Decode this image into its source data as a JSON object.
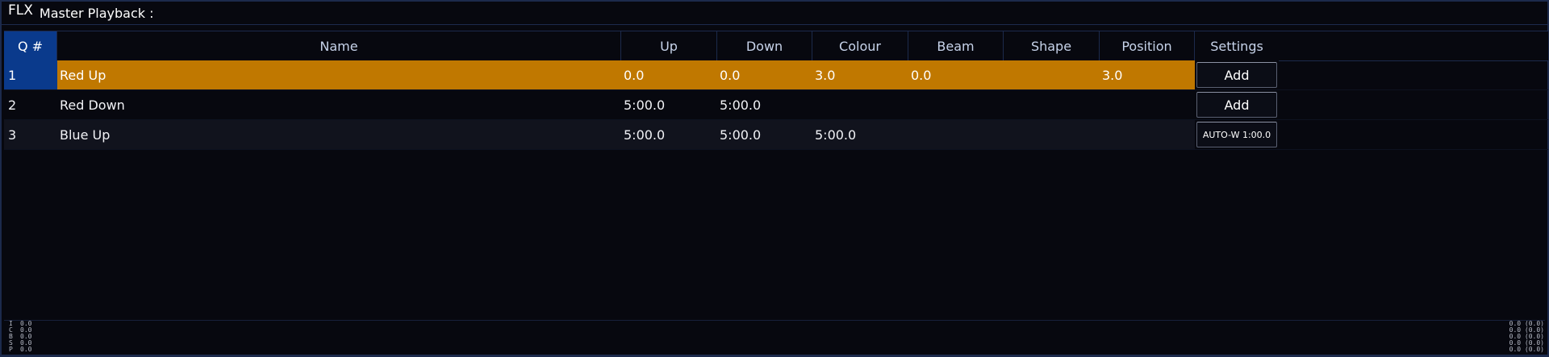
{
  "app": {
    "logo": "FLX",
    "title": "Master Playback :"
  },
  "colors": {
    "active_row": "#c07800",
    "q_column": "#0a3a8c",
    "background": "#07080f"
  },
  "table": {
    "columns": [
      "Q #",
      "Name",
      "Up",
      "Down",
      "Colour",
      "Beam",
      "Shape",
      "Position",
      "Settings"
    ],
    "rows": [
      {
        "q": "1",
        "name": "Red Up",
        "up": "0.0",
        "down": "0.0",
        "colour": "3.0",
        "beam": "0.0",
        "shape": "",
        "position": "3.0",
        "settings": "Add"
      },
      {
        "q": "2",
        "name": "Red Down",
        "up": "5:00.0",
        "down": "5:00.0",
        "colour": "",
        "beam": "",
        "shape": "",
        "position": "",
        "settings": "Add"
      },
      {
        "q": "3",
        "name": "Blue Up",
        "up": "5:00.0",
        "down": "5:00.0",
        "colour": "5:00.0",
        "beam": "",
        "shape": "",
        "position": "",
        "settings": "AUTO-W 1:00.0"
      }
    ]
  },
  "status": {
    "left": [
      {
        "label": "I",
        "value": "0.0"
      },
      {
        "label": "C",
        "value": "0.0"
      },
      {
        "label": "B",
        "value": "0.0"
      },
      {
        "label": "S",
        "value": "0.0"
      },
      {
        "label": "P",
        "value": "0.0"
      }
    ],
    "right": [
      "0.0 (0.0)",
      "0.0 (0.0)",
      "0.0 (0.0)",
      "0.0 (0.0)",
      "0.0 (0.0)"
    ]
  }
}
